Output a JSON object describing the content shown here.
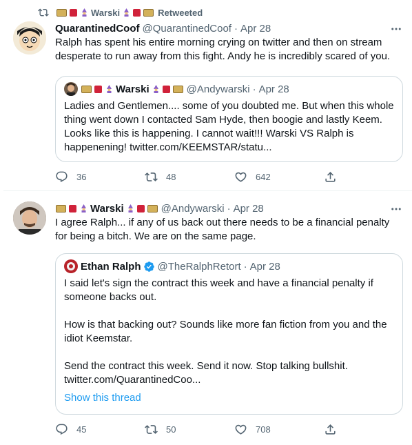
{
  "tweets": [
    {
      "retweet": {
        "user_display": "Warski",
        "label": "Retweeted"
      },
      "author": {
        "name": "QuarantinedCoof",
        "handle": "@QuarantinedCoof",
        "separator": "·",
        "date": "Apr 28"
      },
      "text": "Ralph has spent his entire morning crying on twitter and then on stream desperate to run away from this fight.  Andy he is incredibly scared of you.",
      "quote": {
        "name": "Warski",
        "handle": "@Andywarski",
        "separator": "·",
        "date": "Apr 28",
        "text": "Ladies and Gentlemen.... some of you doubted me. But when this whole thing went down I contacted Sam Hyde,  then boogie and lastly Keem.  Looks like this is happening. I cannot wait!!! Warski VS Ralph is happenening! twitter.com/KEEMSTAR/statu..."
      },
      "stats": {
        "replies": "36",
        "retweets": "48",
        "likes": "642"
      }
    },
    {
      "author": {
        "name": "Warski",
        "handle": "@Andywarski",
        "separator": "·",
        "date": "Apr 28"
      },
      "text": "I agree Ralph... if any of us back out there needs to be a financial penalty for being a bitch. We are on the same page.",
      "quote": {
        "name": "Ethan Ralph",
        "handle": "@TheRalphRetort",
        "separator": "·",
        "date": "Apr 28",
        "text": "I said let's sign the contract this week and have a financial penalty if someone backs out.\n\nHow is that backing out? Sounds like more fan fiction from you and the idiot Keemstar.\n\nSend the contract this week. Send it now. Stop talking bullshit. twitter.com/QuarantinedCoo...",
        "show_thread": "Show this thread"
      },
      "stats": {
        "replies": "45",
        "retweets": "50",
        "likes": "708"
      }
    }
  ],
  "colors": {
    "text": "#0f1419",
    "secondary": "#536471",
    "link": "#1d9bf0",
    "border": "#cfd9de",
    "verified": "#1d9bf0"
  },
  "icons": [
    "retweet-icon",
    "more-icon",
    "reply-icon",
    "retweet-icon",
    "like-icon",
    "share-icon",
    "verified-icon",
    "slot-machine-emoji",
    "dice-emoji",
    "mage-emoji"
  ]
}
